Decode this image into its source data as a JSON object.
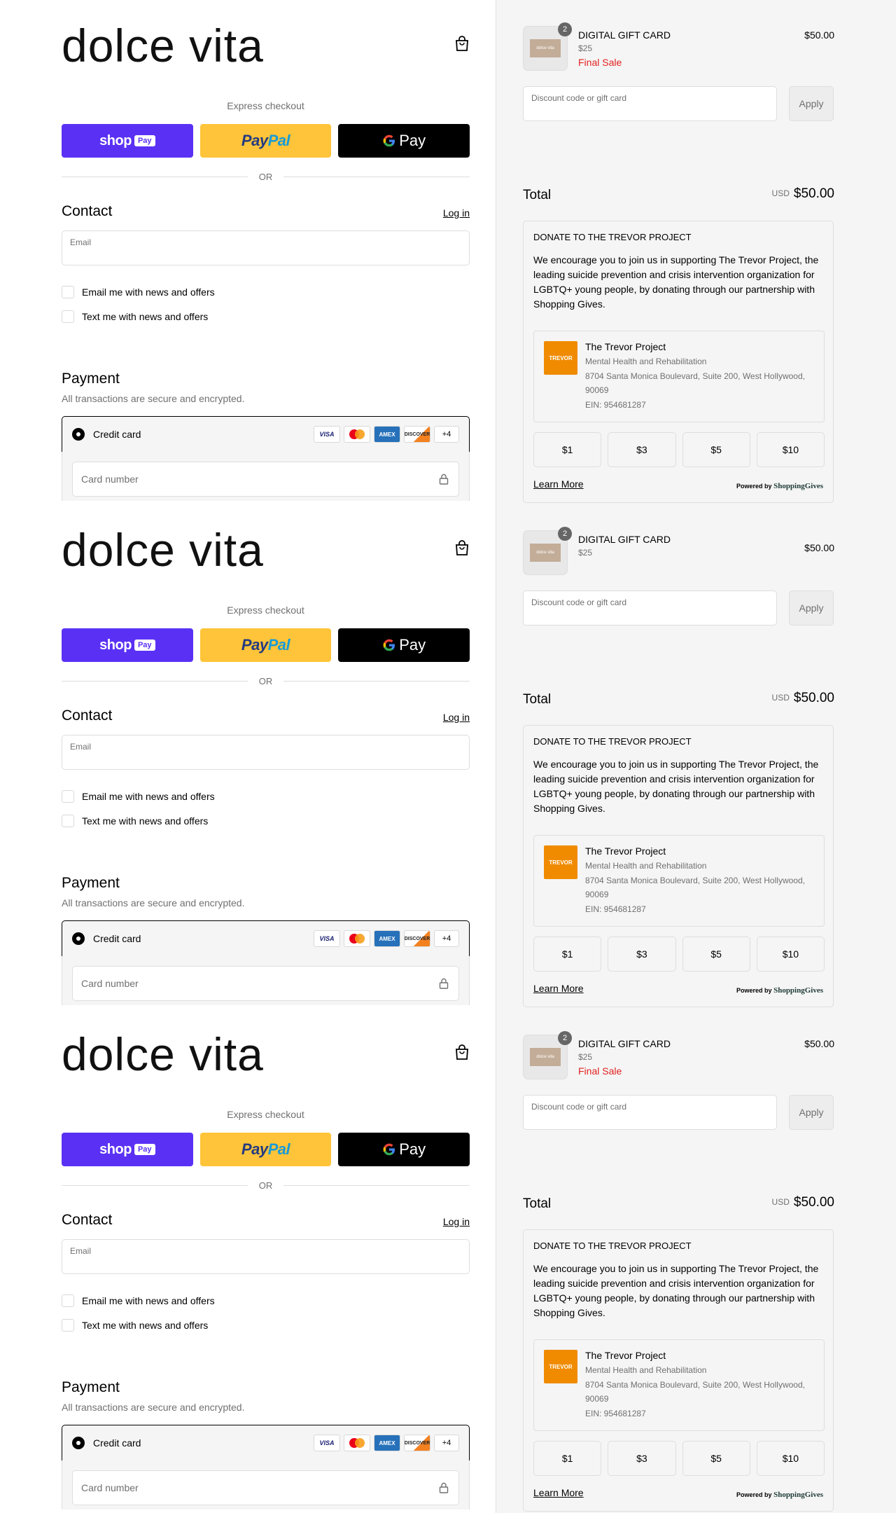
{
  "store": {
    "logo_text": "dolce vita"
  },
  "express": {
    "label": "Express checkout",
    "shop_text": "shop",
    "shop_pill": "Pay",
    "paypal_pay": "Pay",
    "paypal_pal": "Pal",
    "gpay_text": "Pay",
    "or_text": "OR"
  },
  "contact": {
    "title": "Contact",
    "login": "Log in",
    "email_label": "Email",
    "email_value": "",
    "option_email": "Email me with news and offers",
    "option_text": "Text me with news and offers"
  },
  "payment": {
    "title": "Payment",
    "subtitle": "All transactions are secure and encrypted.",
    "method": "Credit card",
    "card_icons": [
      "VISA",
      "MC",
      "AMEX",
      "DISCOVER"
    ],
    "more_cards": "+4",
    "card_number_placeholder": "Card number"
  },
  "order": {
    "item_title": "DIGITAL GIFT CARD",
    "item_variant": "$25",
    "item_sale": "Final Sale",
    "item_price": "$50.00",
    "item_qty": "2",
    "thumb_text": "dolce vita",
    "discount_label": "Discount code or gift card",
    "apply": "Apply",
    "total_label": "Total",
    "total_currency": "USD",
    "total_value": "$50.00"
  },
  "donation": {
    "title": "DONATE TO THE TREVOR PROJECT",
    "body": "We encourage you to join us in supporting The Trevor Project, the leading suicide prevention and crisis intervention organization for LGBTQ+ young people, by donating through our partnership with Shopping Gives.",
    "org_logo": "TREVOR",
    "org_name": "The Trevor Project",
    "org_category": "Mental Health and Rehabilitation",
    "org_address": "8704 Santa Monica Boulevard, Suite 200, West Hollywood, 90069",
    "org_ein": "EIN: 954681287",
    "amounts": [
      "$1",
      "$3",
      "$5",
      "$10"
    ],
    "learn_more": "Learn More",
    "powered_by": "Powered by",
    "powered_brand": "ShoppingGives"
  },
  "colors": {
    "shop_pay": "#5a31f4",
    "paypal": "#ffc439",
    "gpay": "#000000",
    "sale": "#e22120",
    "trevor": "#f08b00"
  }
}
